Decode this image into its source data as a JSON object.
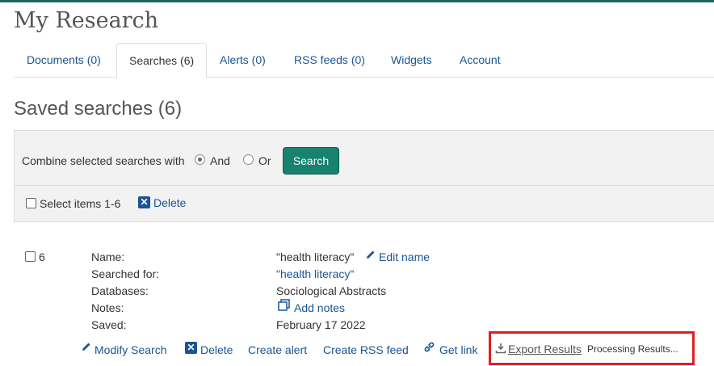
{
  "page": {
    "title": "My Research"
  },
  "tabs": [
    {
      "label": "Documents (0)"
    },
    {
      "label": "Searches (6)",
      "active": true
    },
    {
      "label": "Alerts (0)"
    },
    {
      "label": "RSS feeds (0)"
    },
    {
      "label": "Widgets"
    },
    {
      "label": "Account"
    }
  ],
  "section": {
    "title": "Saved searches (6)"
  },
  "combine": {
    "label": "Combine selected searches with",
    "option_and": "And",
    "option_or": "Or",
    "selected": "And",
    "search_button": "Search"
  },
  "bulk": {
    "select_label": "Select items 1-6",
    "delete_label": "Delete"
  },
  "saved_search": {
    "number": "6",
    "fields": {
      "name_label": "Name:",
      "name_value": "\"health literacy\"",
      "edit_name": "Edit name",
      "searched_for_label": "Searched for:",
      "searched_for_value": "\"health literacy\"",
      "databases_label": "Databases:",
      "databases_value": "Sociological Abstracts",
      "notes_label": "Notes:",
      "add_notes": "Add notes",
      "saved_label": "Saved:",
      "saved_value": "February 17 2022"
    },
    "actions": {
      "modify": "Modify Search",
      "delete": "Delete",
      "create_alert": "Create alert",
      "create_rss": "Create RSS feed",
      "get_link": "Get link",
      "export": "Export Results",
      "processing": "Processing Results..."
    }
  },
  "colors": {
    "accent": "#17826f",
    "link": "#1a5594",
    "highlight": "#e02020"
  }
}
